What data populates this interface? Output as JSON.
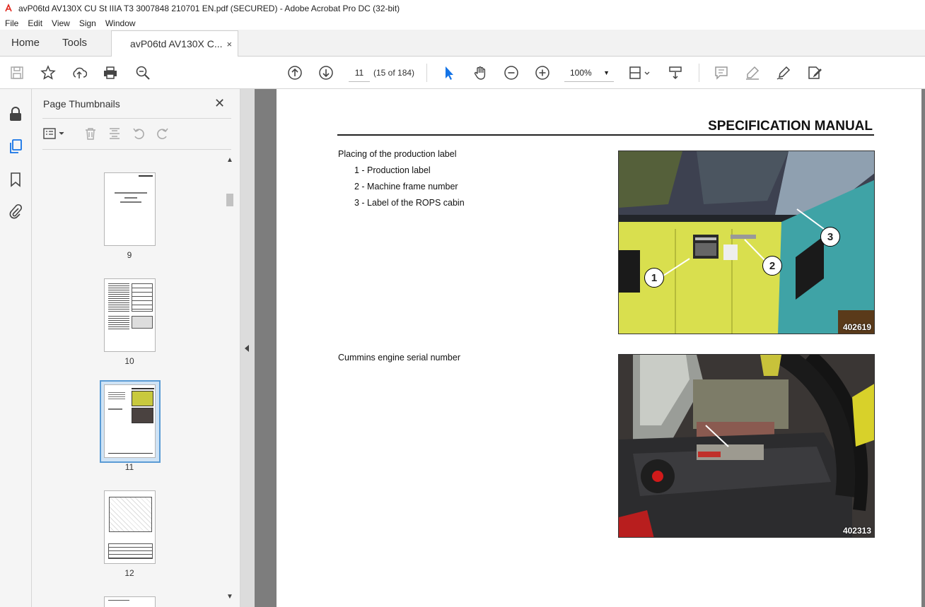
{
  "window": {
    "title": "avP06td AV130X CU St IIIA T3 3007848 210701 EN.pdf (SECURED) - Adobe Acrobat Pro DC (32-bit)"
  },
  "menu": [
    "File",
    "Edit",
    "View",
    "Sign",
    "Window"
  ],
  "tabs": {
    "home": "Home",
    "tools": "Tools",
    "document": "avP06td AV130X C...",
    "close": "×"
  },
  "toolbar": {
    "page_current": "11",
    "page_count": "(15 of 184)",
    "zoom": "100%",
    "icons": [
      "save-icon",
      "star-icon",
      "upload-icon",
      "print-icon",
      "search-zoom-icon",
      "page-up-icon",
      "page-down-icon",
      "select-cursor-icon",
      "hand-icon",
      "zoom-out-icon",
      "zoom-in-icon",
      "fit-page-icon",
      "scroll-mode-icon",
      "comment-icon",
      "highlight-icon",
      "sign-icon",
      "edit-pdf-icon"
    ]
  },
  "left_rail": {
    "icons": [
      "lock-icon",
      "pages-icon",
      "bookmark-icon",
      "attachment-icon"
    ]
  },
  "thumbnails_panel": {
    "title": "Page Thumbnails",
    "close": "✕",
    "pages": [
      {
        "label": "9"
      },
      {
        "label": "10"
      },
      {
        "label": "11",
        "selected": true
      },
      {
        "label": "12"
      }
    ]
  },
  "page": {
    "header": "SPECIFICATION MANUAL",
    "section1_title": "Placing of the production label",
    "items": [
      "1 - Production label",
      "2 - Machine frame number",
      "3 - Label of the ROPS cabin"
    ],
    "photo1_number": "402619",
    "callouts": [
      "1",
      "2",
      "3"
    ],
    "section2_title": "Cummins engine serial number",
    "photo2_number": "402313"
  },
  "colors": {
    "accent_blue": "#1473e6",
    "selected_thumb": "#5a9bd5"
  }
}
